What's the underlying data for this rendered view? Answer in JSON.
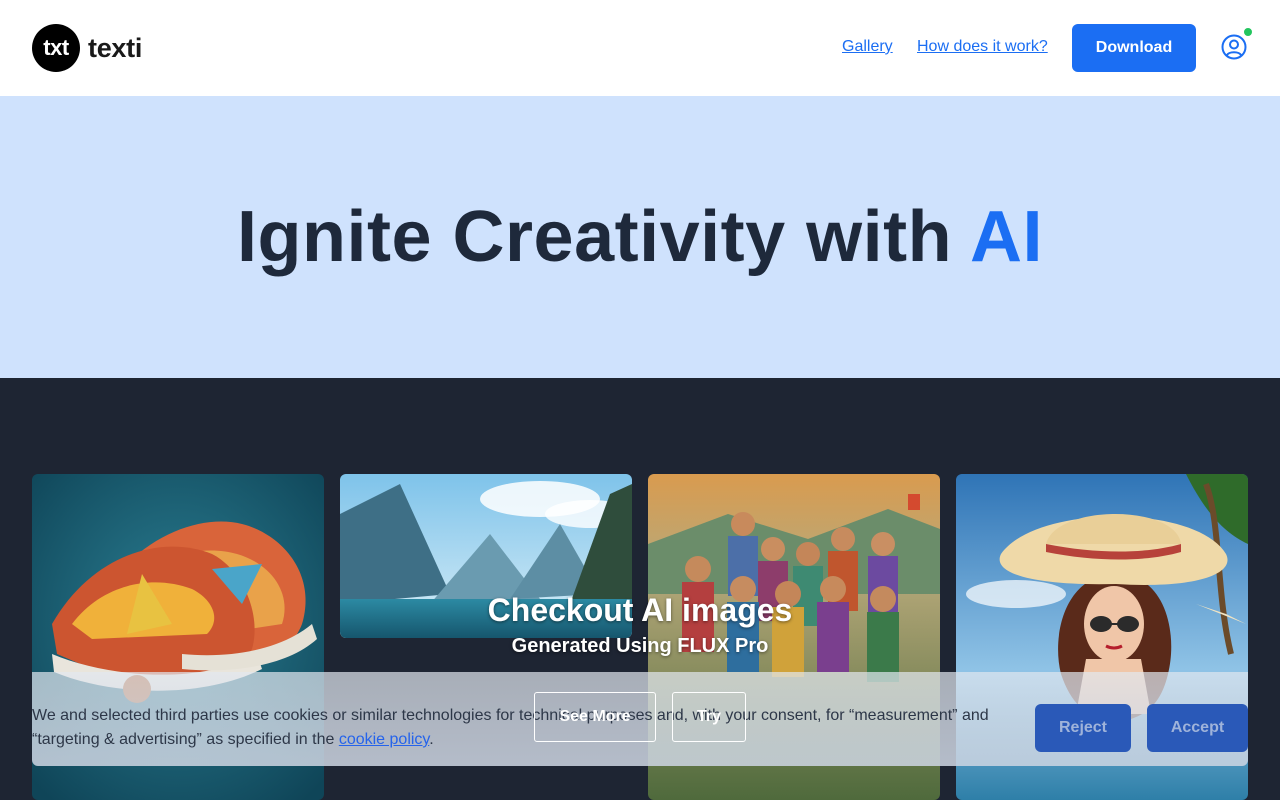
{
  "header": {
    "logo_mark": "txt",
    "logo_text": "texti",
    "nav": {
      "gallery": "Gallery",
      "how_it_works": "How does it work?"
    },
    "download_label": "Download",
    "user_icon": "user-circle-icon",
    "status_color": "#22c55e"
  },
  "hero": {
    "title_main": "Ignite Creativity with",
    "title_accent": "AI"
  },
  "gallery": {
    "images": [
      {
        "subject": "sneakers"
      },
      {
        "subject": "mountain-lake"
      },
      {
        "subject": "children-group"
      },
      {
        "subject": "woman-sun-hat"
      }
    ],
    "overlay_title": "Checkout AI images",
    "overlay_subtitle": "Generated Using FLUX Pro",
    "see_more_label": "See More",
    "try_label": "Try"
  },
  "cookie_banner": {
    "text_line1": "We and selected third parties use cookies or similar technologies for technical purposes and, with your consent, for “measurement” and",
    "text_line2_prefix": "“targeting & advertising” as specified in the ",
    "policy_link": "cookie policy",
    "text_suffix": ".",
    "reject_label": "Reject",
    "accept_label": "Accept"
  },
  "colors": {
    "accent": "#1b6ef3",
    "hero_bg": "#cfe2fd",
    "gallery_bg": "#1e2533",
    "title_text": "#1e293b"
  }
}
